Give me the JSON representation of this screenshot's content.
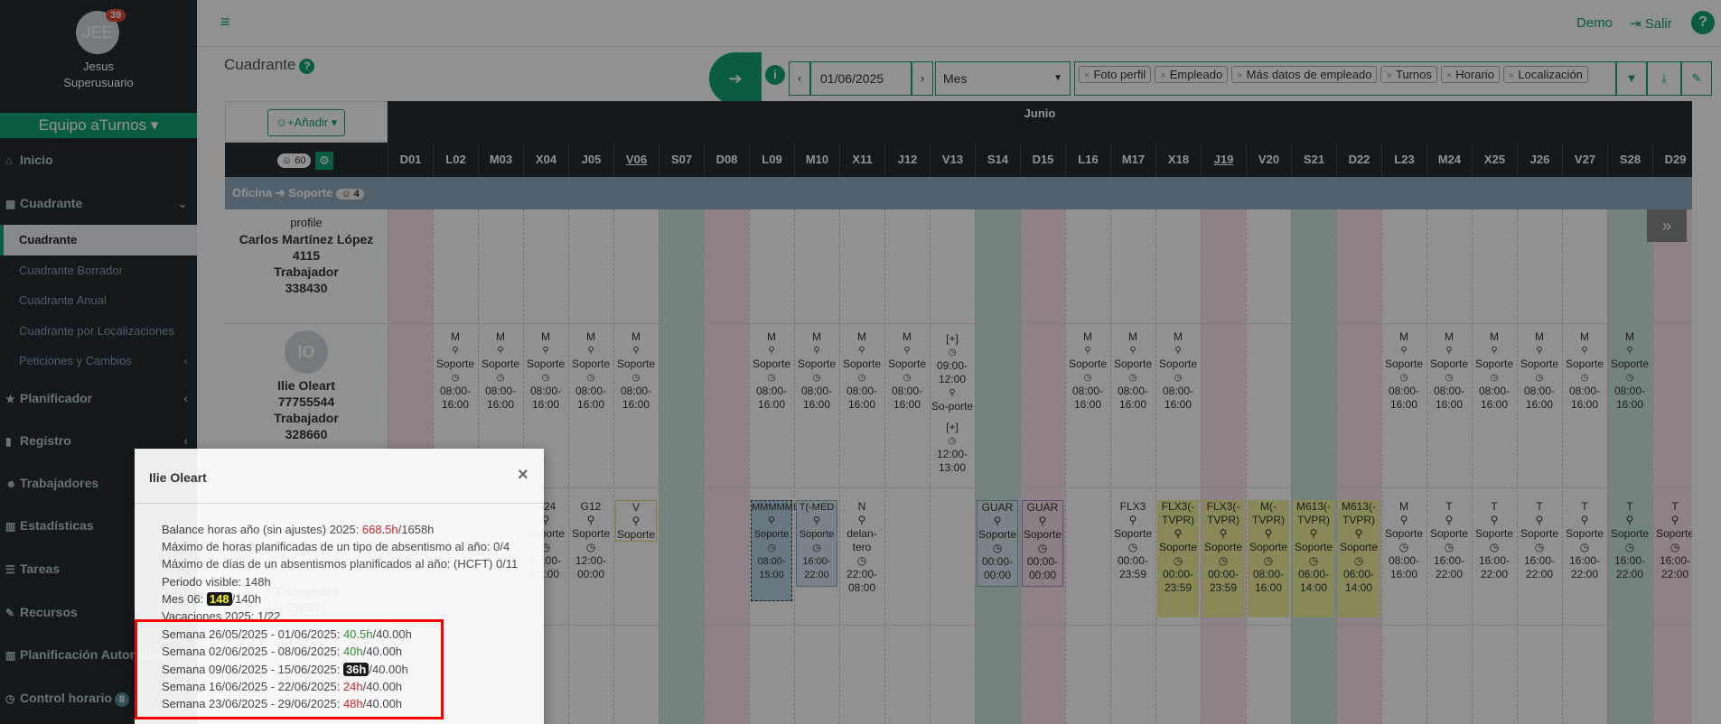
{
  "sidebar": {
    "avatar": "JEE",
    "badge": "39",
    "name": "Jesus",
    "role": "Superusuario",
    "team": "Equipo aTurnos",
    "menu": {
      "inicio": "Inicio",
      "cuadrante": "Cuadrante",
      "cuadrante_sub": "Cuadrante",
      "cuadrante_borrador": "Cuadrante Borrador",
      "cuadrante_anual": "Cuadrante Anual",
      "cuadrante_loc": "Cuadrante por Localizaciones",
      "peticiones": "Peticiones y Cambios",
      "planificador": "Planificador",
      "registro": "Registro",
      "trabajadores": "Trabajadores",
      "estadisticas": "Estadísticas",
      "tareas": "Tareas",
      "recursos": "Recursos",
      "planificacion": "Planificación Automática",
      "control": "Control horario",
      "control_badge": "8"
    }
  },
  "topbar": {
    "demo": "Demo",
    "salir": "Salir"
  },
  "page": {
    "title": "Cuadrante"
  },
  "toolbar": {
    "date": "01/06/2025",
    "view": "Mes",
    "chips": [
      "Foto perfil",
      "Empleado",
      "Más datos de empleado",
      "Turnos",
      "Horario",
      "Localización"
    ]
  },
  "grid": {
    "add_label": "Añadir",
    "month": "Junio",
    "count": "60",
    "group": "Oficina",
    "group_sub": "Soporte",
    "group_count": "4",
    "days": [
      "D01",
      "L02",
      "M03",
      "X04",
      "J05",
      "V06",
      "S07",
      "D08",
      "L09",
      "M10",
      "X11",
      "J12",
      "V13",
      "S14",
      "D15",
      "L16",
      "M17",
      "X18",
      "J19",
      "V20",
      "S21",
      "D22",
      "L23",
      "M24",
      "X25",
      "J26",
      "V27",
      "S28",
      "D29"
    ],
    "emp1": {
      "photo_alt": "profile",
      "name": "Carlos Martínez López",
      "id": "4115",
      "role": "Trabajador",
      "num": "338430"
    },
    "emp2": {
      "avatar": "IO",
      "name": "Ilie Oleart",
      "id": "77755544",
      "role": "Trabajador",
      "num": "328660"
    },
    "emp3": {
      "role": "Trabajador",
      "num": "736371"
    },
    "shift_m": "M",
    "loc": "Soporte",
    "time_start": "08:00-",
    "time_end": "16:00",
    "v13": {
      "tag": "[+]",
      "t1a": "09:00-",
      "t1b": "12:00",
      "loc": "So-porte",
      "tag2": "[+]",
      "t2a": "12:00-",
      "t2b": "13:00"
    },
    "row3": {
      "x04": {
        "name": "G24",
        "a": "08:00-",
        "b": "08:00"
      },
      "j05": {
        "name": "G12",
        "a": "12:00-",
        "b": "00:00"
      },
      "v06": {
        "name": "V"
      },
      "l09": {
        "name": "MMMMMED)",
        "a": "08:00-",
        "b": "15:00"
      },
      "m10": {
        "name": "T(-MED",
        "a": "16:00-",
        "b": "22:00"
      },
      "x11": {
        "name": "N",
        "loc": "delan-tero",
        "a": "22:00-",
        "b": "08:00"
      },
      "s14": {
        "name": "GUAR",
        "a": "00:00-",
        "b": "00:00"
      },
      "d15": {
        "name": "GUAR",
        "a": "00:00-",
        "b": "00:00"
      },
      "m17": {
        "name": "FLX3",
        "a": "00:00-",
        "b": "23:59"
      },
      "x18": {
        "name": "FLX3(-TVPR)",
        "a": "00:00-",
        "b": "23:59"
      },
      "j19": {
        "name": "FLX3(-TVPR)",
        "a": "00:00-",
        "b": "23:59"
      },
      "v20": {
        "name": "M(-TVPR)",
        "a": "08:00-",
        "b": "16:00"
      },
      "s21": {
        "name": "M613(-TVPR)",
        "a": "06:00-",
        "b": "14:00"
      },
      "d22": {
        "name": "M613(-TVPR)",
        "a": "06:00-",
        "b": "14:00"
      },
      "l23": {
        "name": "M",
        "a": "08:00-",
        "b": "16:00"
      },
      "t": {
        "name": "T",
        "a": "16:00-",
        "b": "22:00"
      }
    }
  },
  "modal": {
    "title": "Ilie Oleart",
    "balance_label": "Balance horas año (sin ajustes) 2025:",
    "balance_val": "668.5h",
    "balance_total": "/1658h",
    "max_horas": "Máximo de horas planificadas de un tipo de absentismo al año: 0/4",
    "max_dias": "Máximo de días de un absentismos planificados al año: (HCFT) 0/11",
    "periodo": "Periodo visible: 148h",
    "mes_label": "Mes 06:",
    "mes_val": "148",
    "mes_total": "/140h",
    "vacaciones": "Vacaciones 2025: 1/22",
    "weeks": [
      {
        "label": "Semana 26/05/2025 - 01/06/2025:",
        "val": "40.5h",
        "total": "/40.00h"
      },
      {
        "label": "Semana 02/06/2025 - 08/06/2025:",
        "val": "40h",
        "total": "/40.00h"
      },
      {
        "label": "Semana 09/06/2025 - 15/06/2025:",
        "val": "36h",
        "total": "/40.00h"
      },
      {
        "label": "Semana 16/06/2025 - 22/06/2025:",
        "val": "24h",
        "total": "/40.00h"
      },
      {
        "label": "Semana 23/06/2025 - 29/06/2025:",
        "val": "48h",
        "total": "/40.00h"
      }
    ]
  },
  "colors": {
    "accent": "#13a374",
    "sidebar": "#222d32",
    "highlight": "#ff0000"
  }
}
